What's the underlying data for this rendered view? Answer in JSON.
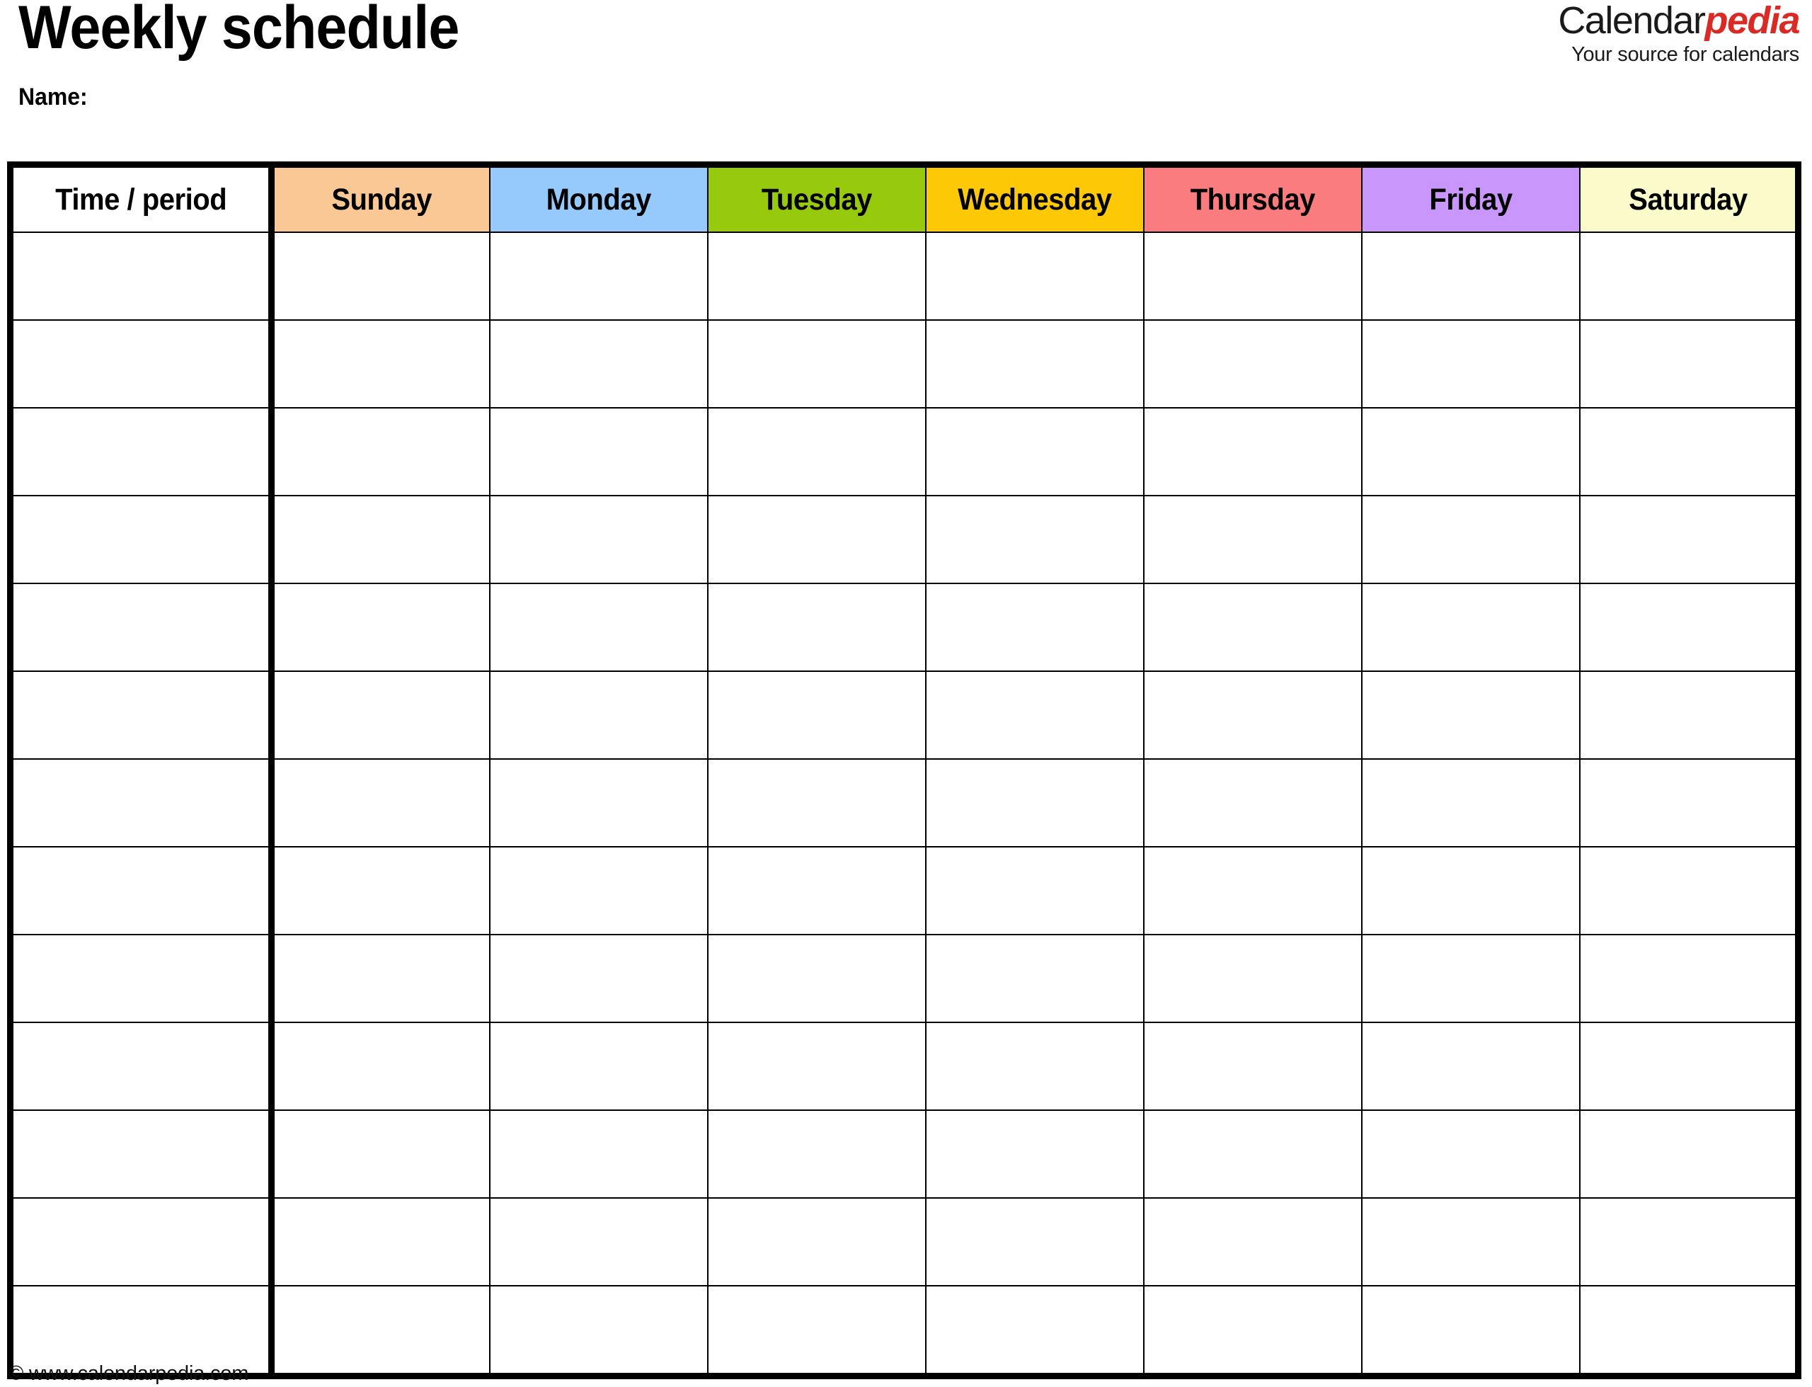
{
  "document": {
    "title": "Weekly schedule",
    "name_label": "Name:",
    "footer_credit": "© www.calendarpedia.com"
  },
  "logo": {
    "word_primary": "Calendar",
    "word_accent": "pedia",
    "tagline": "Your source for calendars",
    "accent_color": "#d92b26",
    "primary_color": "#1a1a1a"
  },
  "table": {
    "row_count": 13,
    "columns": [
      {
        "label": "Time / period",
        "color": "#ffffff",
        "key": "time"
      },
      {
        "label": "Sunday",
        "color": "#fac894",
        "key": "sunday"
      },
      {
        "label": "Monday",
        "color": "#96cafc",
        "key": "monday"
      },
      {
        "label": "Tuesday",
        "color": "#97c90d",
        "key": "tuesday"
      },
      {
        "label": "Wednesday",
        "color": "#fdc805",
        "key": "wednesday"
      },
      {
        "label": "Thursday",
        "color": "#fb7c7e",
        "key": "thursday"
      },
      {
        "label": "Friday",
        "color": "#c997fb",
        "key": "friday"
      },
      {
        "label": "Saturday",
        "color": "#fbfacb",
        "key": "saturday"
      }
    ],
    "rows": [
      [
        "",
        "",
        "",
        "",
        "",
        "",
        "",
        ""
      ],
      [
        "",
        "",
        "",
        "",
        "",
        "",
        "",
        ""
      ],
      [
        "",
        "",
        "",
        "",
        "",
        "",
        "",
        ""
      ],
      [
        "",
        "",
        "",
        "",
        "",
        "",
        "",
        ""
      ],
      [
        "",
        "",
        "",
        "",
        "",
        "",
        "",
        ""
      ],
      [
        "",
        "",
        "",
        "",
        "",
        "",
        "",
        ""
      ],
      [
        "",
        "",
        "",
        "",
        "",
        "",
        "",
        ""
      ],
      [
        "",
        "",
        "",
        "",
        "",
        "",
        "",
        ""
      ],
      [
        "",
        "",
        "",
        "",
        "",
        "",
        "",
        ""
      ],
      [
        "",
        "",
        "",
        "",
        "",
        "",
        "",
        ""
      ],
      [
        "",
        "",
        "",
        "",
        "",
        "",
        "",
        ""
      ],
      [
        "",
        "",
        "",
        "",
        "",
        "",
        "",
        ""
      ],
      [
        "",
        "",
        "",
        "",
        "",
        "",
        "",
        ""
      ]
    ]
  }
}
